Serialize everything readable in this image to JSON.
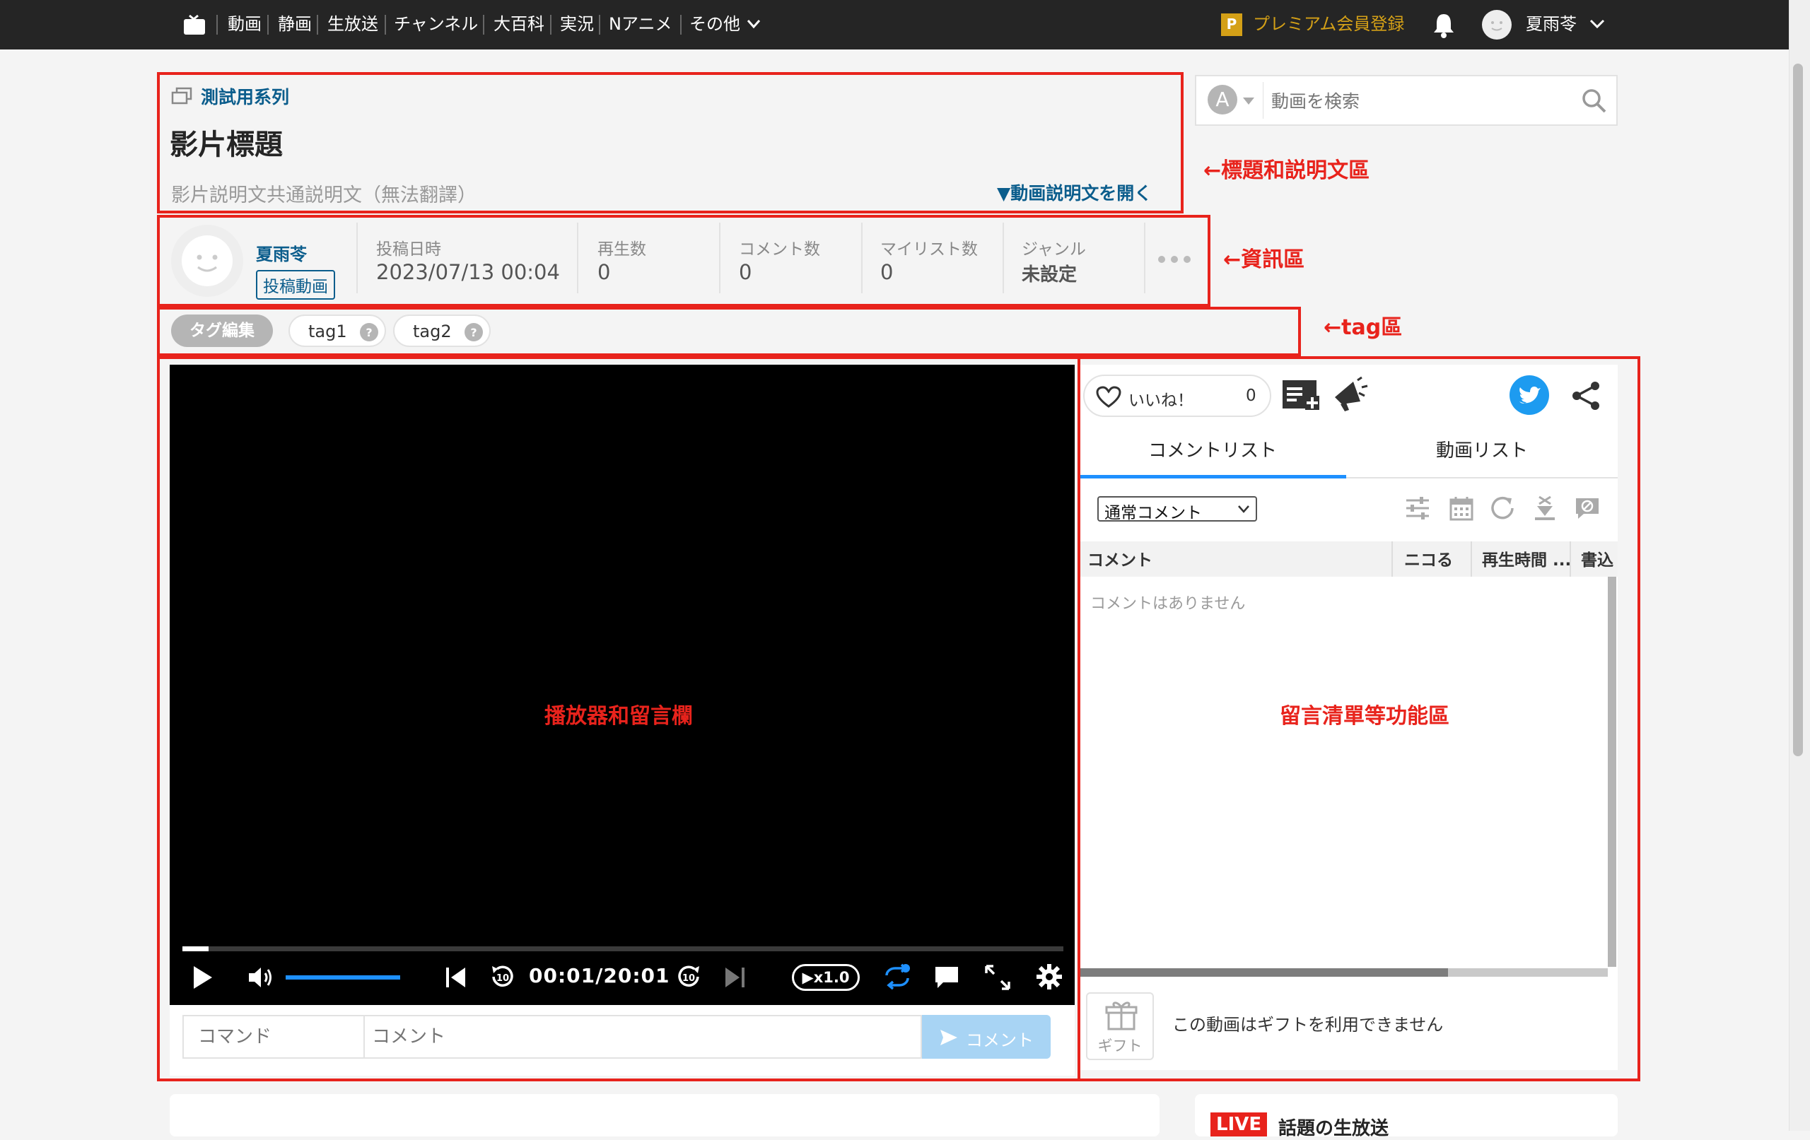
{
  "nav": {
    "items": [
      "動画",
      "静画",
      "生放送",
      "チャンネル",
      "大百科",
      "実況",
      "Nアニメ",
      "その他"
    ],
    "premium_label": "プレミアム会員登録",
    "user_name": "夏雨苓"
  },
  "search": {
    "placeholder": "動画を検索"
  },
  "video": {
    "series": "測試用系列",
    "title": "影片標題",
    "description": "影片説明文共通説明文（無法翻譯）",
    "open_description": "▼動画説明文を開く"
  },
  "info": {
    "uploader_name": "夏雨苓",
    "uploader_link": "投稿動画",
    "cells": [
      {
        "label": "投稿日時",
        "value": "2023/07/13 00:04"
      },
      {
        "label": "再生数",
        "value": "0"
      },
      {
        "label": "コメント数",
        "value": "0"
      },
      {
        "label": "マイリスト数",
        "value": "0"
      },
      {
        "label": "ジャンル",
        "value": "未設定"
      }
    ]
  },
  "tags": {
    "edit_label": "タグ編集",
    "items": [
      "tag1",
      "tag2"
    ]
  },
  "player": {
    "time": "00:01/20:01",
    "speed": "▶x1.0",
    "progress": 0.03,
    "volume": 1.0,
    "command_placeholder": "コマンド",
    "comment_placeholder": "コメント",
    "submit_label": "コメント"
  },
  "side": {
    "like_label": "いいね！",
    "like_count": "0",
    "tabs": [
      "コメントリスト",
      "動画リスト"
    ],
    "filter_value": "通常コメント",
    "columns": [
      "コメント",
      "ニコる",
      "再生時間 ...",
      "書込"
    ],
    "empty_text": "コメントはありません",
    "gift_label": "ギフト",
    "gift_text": "この動画はギフトを利用できません"
  },
  "annotations": {
    "title_area": "←標題和説明文區",
    "info_area": "←資訊區",
    "tag_area": "←tag區",
    "player_area": "播放器和留言欄",
    "panel_area": "留言清單等功能區"
  },
  "bottom": {
    "live_badge": "LIVE",
    "live_title": "話題の生放送"
  },
  "colors": {
    "accent_red": "#e8231c",
    "link_blue": "#0b5d8c",
    "player_blue": "#1e90ff",
    "premium_gold": "#d4a017",
    "twitter_blue": "#1d9bf0"
  }
}
